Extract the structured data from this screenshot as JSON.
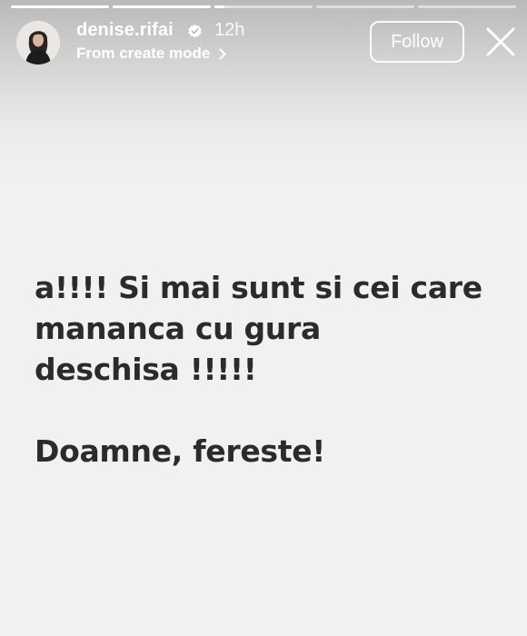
{
  "progress": {
    "segments": [
      1,
      1,
      0.1,
      0,
      0
    ],
    "color": "#ffffff"
  },
  "header": {
    "username": "denise.rifai",
    "time": "12h",
    "subtitle": "From create mode",
    "follow_label": "Follow",
    "verified_icon": "verified-badge-icon",
    "close_icon": "close-icon"
  },
  "story": {
    "paragraph1_line1": "a!!!! Si mai sunt si cei care",
    "paragraph1_line2": "mananca cu gura",
    "paragraph1_line3": "deschisa !!!!!",
    "paragraph2": "Doamne, fereste!",
    "text_color": "#2b2b2b",
    "background_color": "#f1f1f1"
  }
}
